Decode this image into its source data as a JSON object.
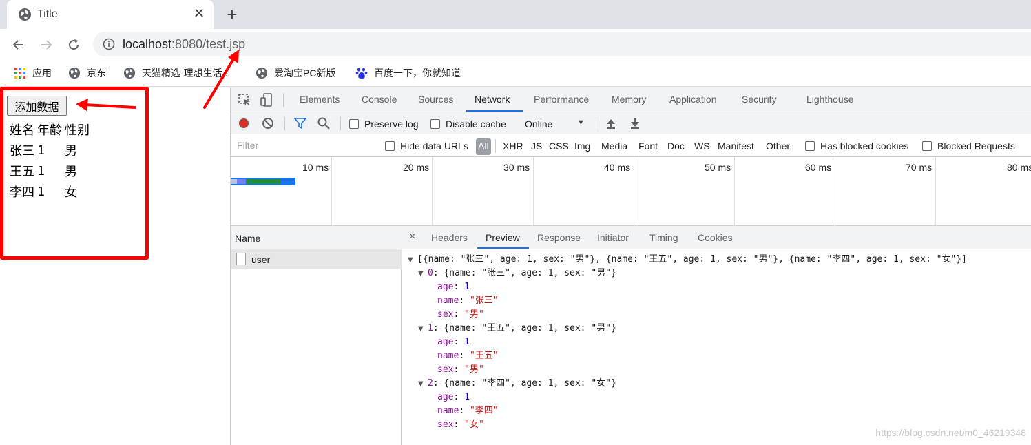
{
  "browser": {
    "tab_title": "Title",
    "tab_close": "✕",
    "new_tab": "+",
    "url_host": "localhost",
    "url_rest": ":8080/test.jsp",
    "bookmarks": [
      "应用",
      "京东",
      "天猫精选-理想生活...",
      "爱淘宝PC新版",
      "百度一下，你就知道"
    ]
  },
  "page": {
    "add_button": "添加数据",
    "table_headers": [
      "姓名",
      "年龄",
      "性别"
    ],
    "rows": [
      [
        "张三",
        "1",
        "男"
      ],
      [
        "王五",
        "1",
        "男"
      ],
      [
        "李四",
        "1",
        "女"
      ]
    ]
  },
  "devtools": {
    "tabs": [
      "Elements",
      "Console",
      "Sources",
      "Network",
      "Performance",
      "Memory",
      "Application",
      "Security",
      "Lighthouse"
    ],
    "active_tab": "Network",
    "toolbar": {
      "preserve_log": "Preserve log",
      "disable_cache": "Disable cache",
      "throttling": "Online",
      "throttling_caret": "▼"
    },
    "filter": {
      "placeholder": "Filter",
      "hide_data_urls": "Hide data URLs",
      "types": [
        "All",
        "XHR",
        "JS",
        "CSS",
        "Img",
        "Media",
        "Font",
        "Doc",
        "WS",
        "Manifest",
        "Other"
      ],
      "has_blocked_cookies": "Has blocked cookies",
      "blocked_requests": "Blocked Requests"
    },
    "timeline_labels": [
      "10 ms",
      "20 ms",
      "30 ms",
      "40 ms",
      "50 ms",
      "60 ms",
      "70 ms",
      "80 ms"
    ],
    "requests_header": "Name",
    "requests": [
      "user"
    ],
    "detail_close": "×",
    "detail_tabs": [
      "Headers",
      "Preview",
      "Response",
      "Initiator",
      "Timing",
      "Cookies"
    ],
    "active_detail_tab": "Preview",
    "preview": {
      "summary": "[{name: \"张三\", age: 1, sex: \"男\"}, {name: \"王五\", age: 1, sex: \"男\"}, {name: \"李四\", age: 1, sex: \"女\"}]",
      "items": [
        {
          "index": "0",
          "summary": "{name: \"张三\", age: 1, sex: \"男\"}",
          "age": "1",
          "name": "\"张三\"",
          "sex": "\"男\""
        },
        {
          "index": "1",
          "summary": "{name: \"王五\", age: 1, sex: \"男\"}",
          "age": "1",
          "name": "\"王五\"",
          "sex": "\"男\""
        },
        {
          "index": "2",
          "summary": "{name: \"李四\", age: 1, sex: \"女\"}",
          "age": "1",
          "name": "\"李四\"",
          "sex": "\"女\""
        }
      ],
      "keys": {
        "age": "age",
        "name": "name",
        "sex": "sex"
      }
    },
    "watermark": "https://blog.csdn.net/m0_46219348"
  },
  "colors": {
    "annotation_red": "#ff0000",
    "accent_blue": "#1a73e8",
    "record_red": "#d93025"
  }
}
